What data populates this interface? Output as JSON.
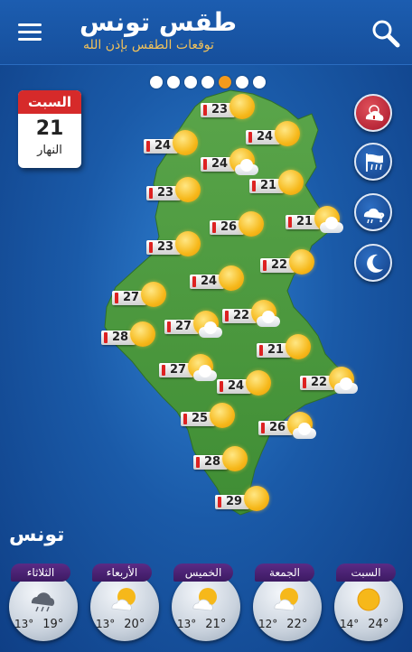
{
  "header": {
    "title": "طقس تونس",
    "subtitle": "توقعات الطقس بإذن الله"
  },
  "icons": {
    "menu": "hamburger-icon",
    "search": "search-icon",
    "weather_alert": "cloud-sun-alert-icon",
    "rain": "rain-icon",
    "unknown_weather": "cloud-question-icon",
    "night": "moon-icon"
  },
  "pager": {
    "count": 7,
    "active_index": 4
  },
  "calendar": {
    "day_name": "السبت",
    "day_number": "21",
    "period": "النهار"
  },
  "map_markers": [
    {
      "temp": "23",
      "cond": "sun"
    },
    {
      "temp": "24",
      "cond": "sun"
    },
    {
      "temp": "24",
      "cond": "sun"
    },
    {
      "temp": "24",
      "cond": "sun-cloud"
    },
    {
      "temp": "23",
      "cond": "sun"
    },
    {
      "temp": "21",
      "cond": "sun"
    },
    {
      "temp": "26",
      "cond": "sun"
    },
    {
      "temp": "21",
      "cond": "sun-cloud"
    },
    {
      "temp": "23",
      "cond": "sun"
    },
    {
      "temp": "22",
      "cond": "sun"
    },
    {
      "temp": "24",
      "cond": "sun"
    },
    {
      "temp": "27",
      "cond": "sun"
    },
    {
      "temp": "22",
      "cond": "sun-cloud"
    },
    {
      "temp": "27",
      "cond": "sun-cloud"
    },
    {
      "temp": "28",
      "cond": "sun"
    },
    {
      "temp": "21",
      "cond": "sun"
    },
    {
      "temp": "27",
      "cond": "sun-cloud"
    },
    {
      "temp": "24",
      "cond": "sun"
    },
    {
      "temp": "22",
      "cond": "sun-cloud"
    },
    {
      "temp": "25",
      "cond": "sun"
    },
    {
      "temp": "26",
      "cond": "sun-cloud"
    },
    {
      "temp": "28",
      "cond": "sun"
    },
    {
      "temp": "29",
      "cond": "sun"
    }
  ],
  "city": {
    "name": "تونس"
  },
  "forecast": [
    {
      "day": "الثلاثاء",
      "min": "13°",
      "max": "19°",
      "cond": "rain-cloud"
    },
    {
      "day": "الأربعاء",
      "min": "13°",
      "max": "20°",
      "cond": "sun-cloud"
    },
    {
      "day": "الخميس",
      "min": "13°",
      "max": "21°",
      "cond": "sun-cloud"
    },
    {
      "day": "الجمعة",
      "min": "12°",
      "max": "22°",
      "cond": "sun-cloud"
    },
    {
      "day": "السبت",
      "min": "14°",
      "max": "24°",
      "cond": "sun"
    }
  ],
  "colors": {
    "accent_orange": "#f39a1c",
    "calendar_red": "#d62a2a",
    "map_green": "#4f9e3e",
    "day_label_purple": "#4a2270"
  }
}
